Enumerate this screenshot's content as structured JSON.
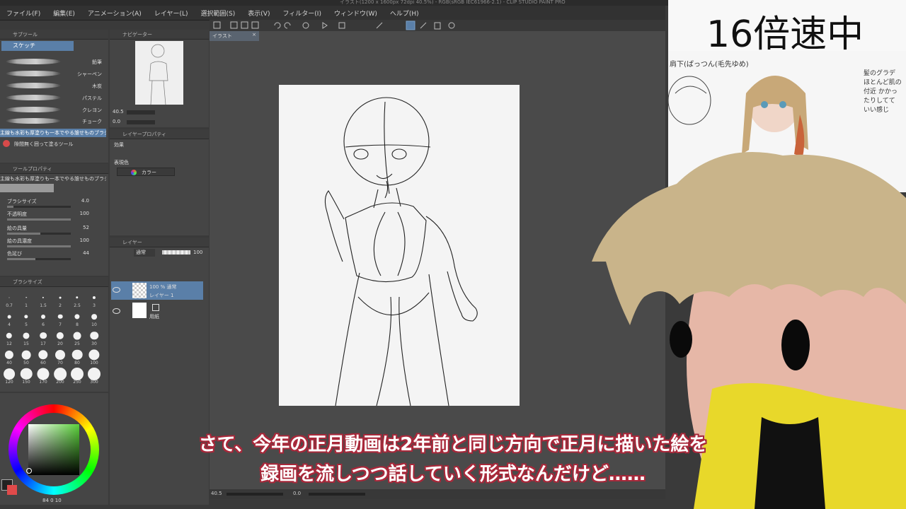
{
  "window": {
    "title": "イラスト(1200 x 1600px 72dpi 40.5%) - RGB(sRGB IEC61966-2.1) - CLIP STUDIO PAINT PRO"
  },
  "menu": [
    "ファイル(F)",
    "編集(E)",
    "アニメーション(A)",
    "レイヤー(L)",
    "選択範囲(S)",
    "表示(V)",
    "フィルター(I)",
    "ウィンドウ(W)",
    "ヘルプ(H)"
  ],
  "subtool": {
    "header": "サブツール",
    "group": "スケッチ",
    "brushes": [
      "鉛筆",
      "シャーペン",
      "木炭",
      "パステル",
      "クレヨン",
      "チョーク"
    ],
    "selected_desc": "主線も水彩も厚塗りも一本でやる誰せものブラシ",
    "next_desc": "隙間無く囲って塗るツール"
  },
  "navigator": {
    "header": "ナビゲーター",
    "zoom": "40.5",
    "angle": "0.0"
  },
  "tool_property": {
    "header": "ツールプロパティ",
    "desc": "主線も水彩も厚塗りも一本でやる誰せものブラシ",
    "rows": [
      {
        "label": "ブラシサイズ",
        "value": "4.0",
        "fill": 0.1
      },
      {
        "label": "不透明度",
        "value": "100",
        "fill": 1.0
      },
      {
        "label": "絵の具量",
        "value": "52",
        "fill": 0.52
      },
      {
        "label": "絵の具濃度",
        "value": "100",
        "fill": 1.0
      },
      {
        "label": "色延び",
        "value": "44",
        "fill": 0.44
      }
    ]
  },
  "brush_size": {
    "header": "ブラシサイズ",
    "sizes": [
      "0.7",
      "1",
      "1.5",
      "2",
      "2.5",
      "3",
      "4",
      "5",
      "6",
      "7",
      "8",
      "10",
      "12",
      "15",
      "17",
      "20",
      "25",
      "30",
      "40",
      "50",
      "60",
      "70",
      "80",
      "100",
      "120",
      "150",
      "170",
      "200",
      "250",
      "300"
    ]
  },
  "layer_property": {
    "header": "レイヤープロパティ",
    "effect_label": "効果",
    "color_label": "表現色",
    "color_value": "カラー"
  },
  "layers": {
    "header": "レイヤー",
    "blend": "通常",
    "opacity": "100",
    "items": [
      {
        "line1": "100 % 通常",
        "line2": "レイヤー 1"
      },
      {
        "line1": "",
        "line2": "用紙"
      }
    ]
  },
  "canvas": {
    "tab": "イラスト",
    "zoom": "40.5",
    "angle": "0.0"
  },
  "color_panel": {
    "readout": "84  0  10"
  },
  "overlay": {
    "speed": "16倍速中",
    "note_top": "肩下(ぱっつん(毛先ゆめ)",
    "note_side": "髪のグラデ ほとんど肌の付近 かかったりしてて いい感じ",
    "subtitle_line1": "さて、今年の正月動画は2年前と同じ方向で正月に描いた絵を",
    "subtitle_line2": "録画を流しつつ話していく形式なんだけど……"
  },
  "colors": {
    "accent": "#5a7fa8",
    "subtitle_outline": "#a8283a",
    "plush_hair": "#c9b48a",
    "plush_jacket": "#e8d82a"
  }
}
